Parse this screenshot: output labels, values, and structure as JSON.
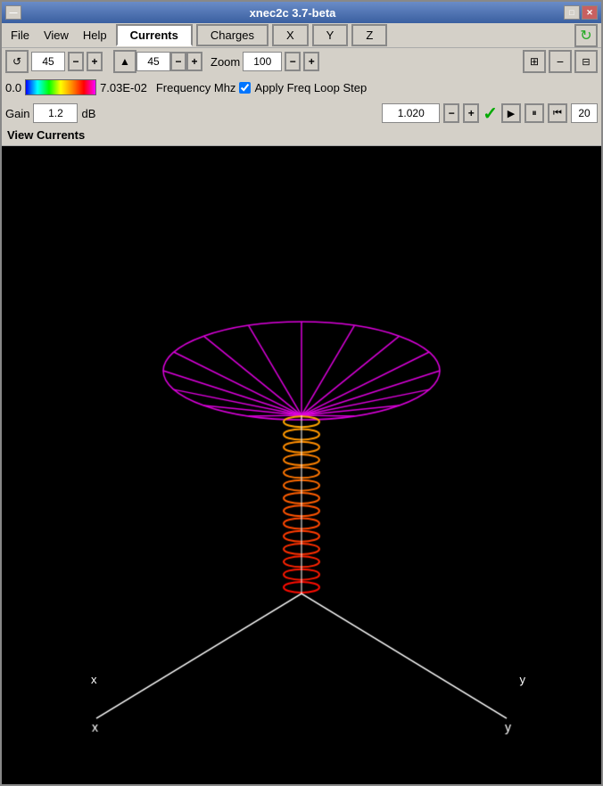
{
  "window": {
    "title": "xnec2c 3.7-beta",
    "titlebar_btns": [
      "—",
      "□",
      "✕"
    ]
  },
  "menu": {
    "file": "File",
    "view": "View",
    "help": "Help"
  },
  "tabs": {
    "currents": "Currents",
    "charges": "Charges",
    "x": "X",
    "y": "Y",
    "z": "Z"
  },
  "toolbar1": {
    "angle1": "45",
    "angle2": "45",
    "zoom_label": "Zoom",
    "zoom_value": "100"
  },
  "toolbar2": {
    "scale_min": "0.0",
    "scale_max": "7.03E-02",
    "freq_label": "Frequency Mhz",
    "apply_freq_loop_step": "Apply Freq Loop Step"
  },
  "toolbar3": {
    "gain_label": "Gain",
    "gain_value": "1.2",
    "db_label": "dB",
    "freq_value": "1.020",
    "step_value": "20"
  },
  "view_label": "View Currents",
  "canvas": {
    "x_label": "x",
    "y_label": "y"
  }
}
